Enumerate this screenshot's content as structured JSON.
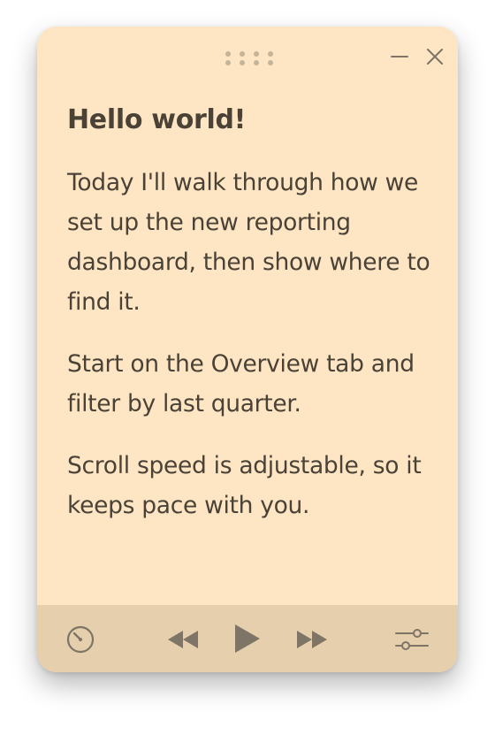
{
  "app": {
    "accent_color": "#fee6c4",
    "toolbar_color": "#e5cfad",
    "text_color": "#4a4236",
    "icon_color": "#7f7566"
  },
  "window_controls": {
    "drag_handle_icon": "grip-dots-icon",
    "minimize_icon": "minimize-icon",
    "close_icon": "close-icon"
  },
  "script": {
    "title": "Hello world!",
    "paragraphs": [
      "Today I'll walk through how we set up the new reporting dashboard, then show where to find it.",
      "Start on the Overview tab and filter by last quarter.",
      "Scroll speed is adjustable, so it keeps pace with you."
    ]
  },
  "toolbar": {
    "speed_icon": "speedometer-icon",
    "rewind_icon": "rewind-icon",
    "play_icon": "play-icon",
    "forward_icon": "fast-forward-icon",
    "settings_icon": "sliders-icon"
  }
}
